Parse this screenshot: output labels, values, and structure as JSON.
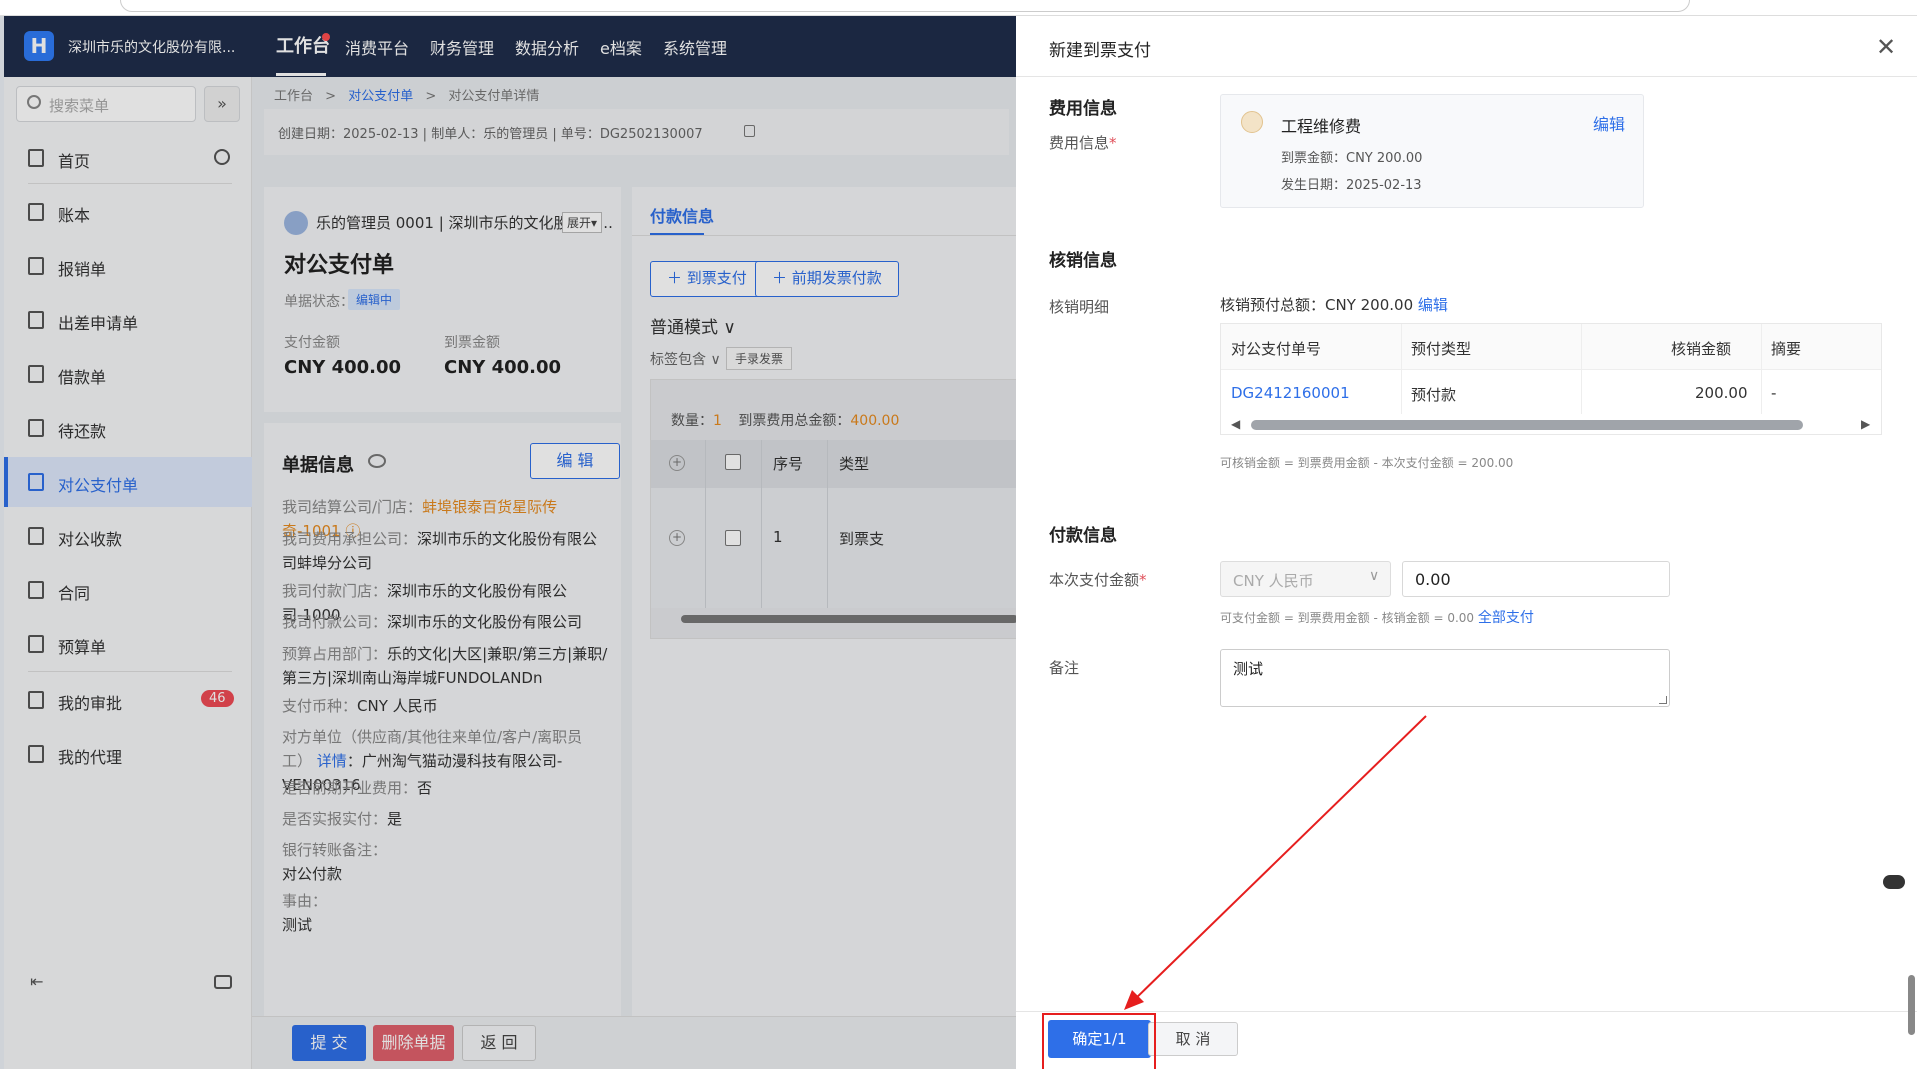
{
  "app": {
    "company": "深圳市乐的文化股份有限...",
    "logo": "H",
    "nav": [
      "工作台",
      "消费平台",
      "财务管理",
      "数据分析",
      "e档案",
      "系统管理"
    ]
  },
  "sidebar": {
    "search_placeholder": "搜索菜单",
    "expand_glyph": "»",
    "items": [
      {
        "label": "首页"
      },
      {
        "label": "账本"
      },
      {
        "label": "报销单"
      },
      {
        "label": "出差申请单"
      },
      {
        "label": "借款单"
      },
      {
        "label": "待还款"
      },
      {
        "label": "对公支付单"
      },
      {
        "label": "对公收款"
      },
      {
        "label": "合同"
      },
      {
        "label": "预算单"
      },
      {
        "label": "我的审批",
        "badge": "46"
      },
      {
        "label": "我的代理"
      }
    ],
    "collapse_glyph": "⇤"
  },
  "breadcrumb": {
    "root": "工作台",
    "mid": "对公支付单",
    "cur": "对公支付单详情",
    "sep": ">"
  },
  "infobar": {
    "text": "创建日期：2025-02-13 | 制单人：乐的管理员 | 单号：DG2502130007"
  },
  "summary": {
    "user_line": "乐的管理员 0001 | 深圳市乐的文化股份有...",
    "expand": "展开▾",
    "title": "对公支付单",
    "status_label": "单据状态：",
    "status": "编辑中",
    "pay_amount_label": "支付金额",
    "pay_amount": "CNY 400.00",
    "invoice_amount_label": "到票金额",
    "invoice_amount": "CNY 400.00"
  },
  "doc_info": {
    "title": "单据信息",
    "edit": "编 辑",
    "fields": [
      {
        "k": "我司结算公司/门店：",
        "v": "蚌埠银泰百货星际传奇-1001 ⓘ",
        "style": "orange"
      },
      {
        "k": "我司费用承担公司：",
        "v": "深圳市乐的文化股份有限公司蚌埠分公司"
      },
      {
        "k": "我司付款门店：",
        "v": "深圳市乐的文化股份有限公司-1000"
      },
      {
        "k": "我司付款公司：",
        "v": "深圳市乐的文化股份有限公司"
      },
      {
        "k": "预算占用部门：",
        "v": "乐的文化|大区|兼职/第三方|兼职/第三方|深圳南山海岸城FUNDOLANDn"
      },
      {
        "k": "支付币种：",
        "v": "CNY 人民币"
      },
      {
        "k": "对方单位（供应商/其他往来单位/客户/离职员工）",
        "link": "详情",
        "v": "：广州淘气猫动漫科技有限公司-VEN00316"
      },
      {
        "k": "是否前期开业费用：",
        "v": "否"
      },
      {
        "k": "是否实报实付：",
        "v": "是"
      },
      {
        "k": "银行转账备注：",
        "v": "对公付款"
      },
      {
        "k": "事由：",
        "v": "测试"
      }
    ]
  },
  "payment": {
    "tab": "付款信息",
    "btn_invoice_pay": "＋ 到票支付",
    "btn_prior_invoice": "＋ 前期发票付款",
    "mode": "普通模式 ∨",
    "tag_label": "标签包含 ∨",
    "tag_chip": "手录发票",
    "count_label": "数量：",
    "count": "1",
    "total_label": "到票费用总金额：",
    "total": "400.00",
    "columns": [
      "序号",
      "类型"
    ],
    "row": {
      "no": "1",
      "type": "到票支"
    }
  },
  "footer": {
    "submit": "提 交",
    "delete": "删除单据",
    "back": "返 回"
  },
  "drawer": {
    "title": "新建到票支付",
    "close": "✕",
    "fee_section": "费用信息",
    "fee_label": "费用信息",
    "fee_name": "工程维修费",
    "fee_edit": "编辑",
    "fee_amount": "到票金额：CNY 200.00",
    "fee_date": "发生日期：2025-02-13",
    "wo_section": "核销信息",
    "wo_label": "核销明细",
    "wo_total": "核销预付总额：CNY 200.00",
    "wo_edit": "编辑",
    "wo_columns": [
      "对公支付单号",
      "预付类型",
      "核销金额",
      "摘要"
    ],
    "wo_row": {
      "no": "DG2412160001",
      "type": "预付款",
      "amount": "200.00",
      "memo": "-"
    },
    "wo_hint": "可核销金额 = 到票费用金额 - 本次支付金额 = 200.00",
    "pay_section": "付款信息",
    "pay_label": "本次支付金额",
    "currency": "CNY 人民币",
    "pay_amount": "0.00",
    "pay_hint": "可支付金额 = 到票费用金额 - 核销金额 = 0.00",
    "pay_all": "全部支付",
    "note_label": "备注",
    "note": "测试",
    "confirm": "确定1/1",
    "cancel": "取 消"
  },
  "colors": {
    "primary": "#2e6fe8",
    "topbar": "#1f2d4b",
    "danger": "#e0606b",
    "annotation": "#e61e1e"
  }
}
